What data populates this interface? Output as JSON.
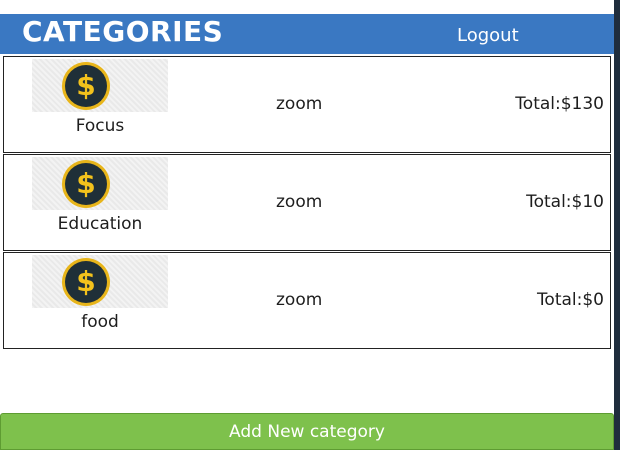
{
  "header": {
    "title": "CATEGORIES",
    "logout_label": "Logout",
    "color": "#3a78c2"
  },
  "categories": [
    {
      "name": "Focus",
      "zoom_label": "zoom",
      "total": "Total:$130",
      "icon": "dollar-coin-icon"
    },
    {
      "name": "Education",
      "zoom_label": "zoom",
      "total": "Total:$10",
      "icon": "dollar-coin-icon"
    },
    {
      "name": "food",
      "zoom_label": "zoom",
      "total": "Total:$0",
      "icon": "dollar-coin-icon"
    }
  ],
  "footer": {
    "add_button_label": "Add New category",
    "color": "#7ec14c"
  }
}
